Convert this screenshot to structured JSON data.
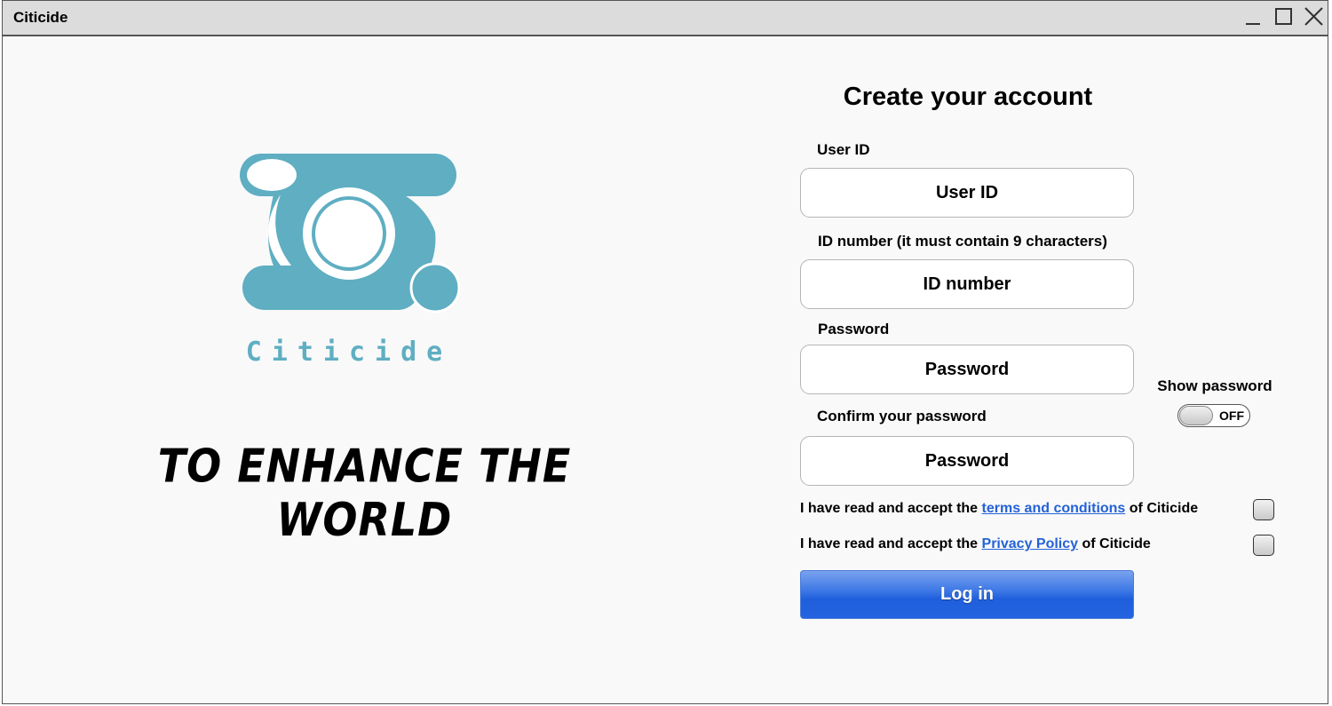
{
  "window": {
    "title": "Citicide"
  },
  "branding": {
    "name": "Citicide",
    "slogan": "TO ENHANCE THE WORLD",
    "logo_color": "#5faec2"
  },
  "form": {
    "title": "Create your account",
    "user_id": {
      "label": "User ID",
      "placeholder": "User ID"
    },
    "id_number": {
      "label": "ID number (it must contain 9 characters)",
      "placeholder": "ID number"
    },
    "password": {
      "label": "Password",
      "placeholder": "Password"
    },
    "confirm_password": {
      "label": "Confirm your password",
      "placeholder": "Password"
    },
    "show_password": {
      "label": "Show password",
      "state": "OFF"
    },
    "terms": {
      "prefix": "I have read and accept the ",
      "link": "terms and conditions",
      "suffix": " of Citicide"
    },
    "privacy": {
      "prefix": "I have read and accept the ",
      "link": "Privacy Policy",
      "suffix": " of Citicide"
    },
    "submit_label": "Log in",
    "accent_color": "#2462d6"
  }
}
